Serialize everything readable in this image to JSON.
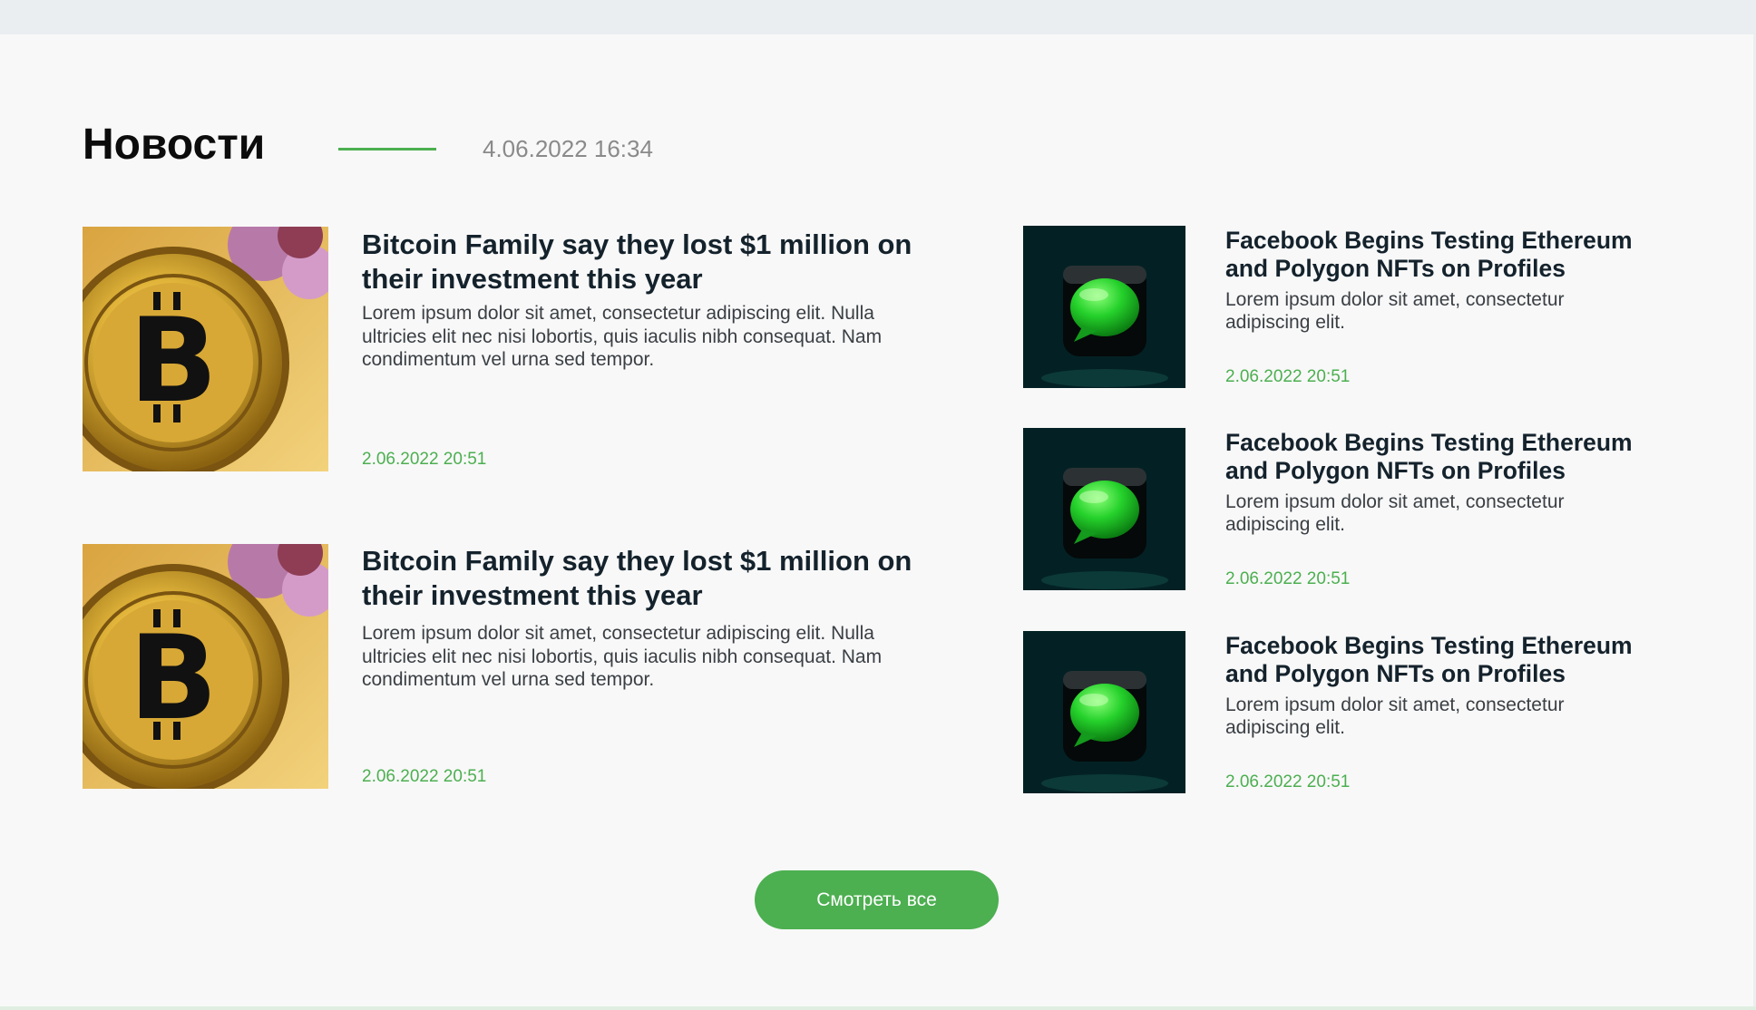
{
  "news": {
    "title": "Новости",
    "date": "4.06.2022 16:34",
    "accent_color": "#4caf50",
    "featured": [
      {
        "image_icon": "bitcoin-coin-icon",
        "title": "Bitcoin Family say they lost $1 million on their investment this year",
        "excerpt": "Lorem ipsum dolor sit amet, consectetur adipiscing elit. Nulla ultricies elit nec nisi lobortis, quis iaculis nibh consequat. Nam condimentum vel urna sed tempor.",
        "date": "2.06.2022 20:51"
      },
      {
        "image_icon": "bitcoin-coin-icon",
        "title": "Bitcoin Family say they lost $1 million on their investment this year",
        "excerpt": "Lorem ipsum dolor sit amet, consectetur adipiscing elit. Nulla ultricies elit nec nisi lobortis, quis iaculis nibh consequat. Nam condimentum vel urna sed tempor.",
        "date": "2.06.2022 20:51"
      }
    ],
    "side": [
      {
        "image_icon": "message-bubble-icon",
        "title": "Facebook Begins Testing Ethereum and Polygon NFTs on Profiles",
        "excerpt": "Lorem ipsum dolor sit amet, consectetur adipiscing elit.",
        "date": "2.06.2022 20:51"
      },
      {
        "image_icon": "message-bubble-icon",
        "title": "Facebook Begins Testing Ethereum and Polygon NFTs on Profiles",
        "excerpt": "Lorem ipsum dolor sit amet, consectetur adipiscing elit.",
        "date": "2.06.2022 20:51"
      },
      {
        "image_icon": "message-bubble-icon",
        "title": "Facebook Begins Testing Ethereum and Polygon NFTs on Profiles",
        "excerpt": "Lorem ipsum dolor sit amet, consectetur adipiscing elit.",
        "date": "2.06.2022 20:51"
      }
    ],
    "view_all_label": "Смотреть все"
  }
}
